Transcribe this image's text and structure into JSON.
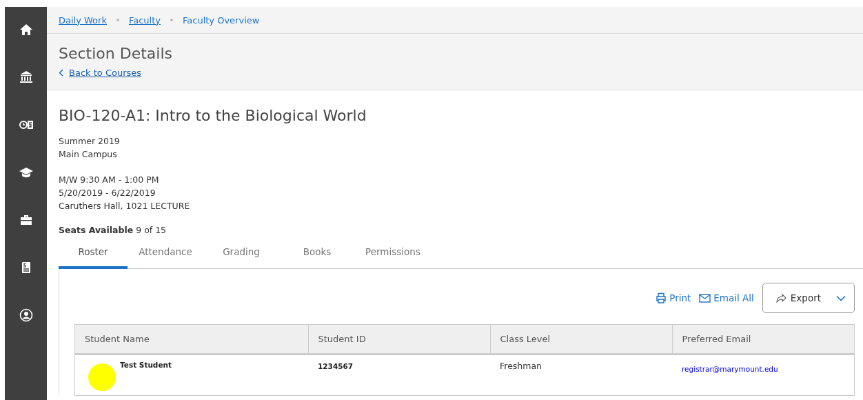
{
  "sidebar": {
    "items": [
      {
        "selected": false
      },
      {
        "selected": false
      },
      {
        "selected": false
      },
      {
        "selected": false
      },
      {
        "selected": false
      },
      {
        "selected": false
      },
      {
        "selected": false
      }
    ]
  },
  "breadcrumbs": [
    {
      "label": "Daily Work",
      "link": true
    },
    {
      "label": "Faculty",
      "link": true
    },
    {
      "label": "Faculty Overview",
      "link": false
    }
  ],
  "page_title": "Section Details",
  "back_link": "Back to Courses",
  "course": {
    "title": "BIO-120-A1: Intro to the Biological World",
    "term_lines": [
      "Summer 2019",
      "Main Campus"
    ],
    "meeting_lines": [
      "M/W 9:30 AM - 1:00 PM",
      "5/20/2019 - 6/22/2019",
      "Caruthers Hall, 1021 LECTURE"
    ],
    "seats_label": "Seats Available",
    "seats_value": "9 of 15"
  },
  "tabs": [
    {
      "label": "Roster",
      "selected": true
    },
    {
      "label": "Attendance",
      "selected": false
    },
    {
      "label": "Grading",
      "selected": false
    },
    {
      "label": "Books",
      "selected": false
    },
    {
      "label": "Permissions",
      "selected": false
    }
  ],
  "actions": {
    "print": "Print",
    "email_all": "Email All",
    "export": "Export"
  },
  "table": {
    "columns": [
      "Student Name",
      "Student ID",
      "Class Level",
      "Preferred Email"
    ],
    "rows": [
      {
        "name": "Test Student",
        "id": "1234567",
        "class_level": "Freshman",
        "email": "registrar@marymount.edu"
      }
    ]
  }
}
